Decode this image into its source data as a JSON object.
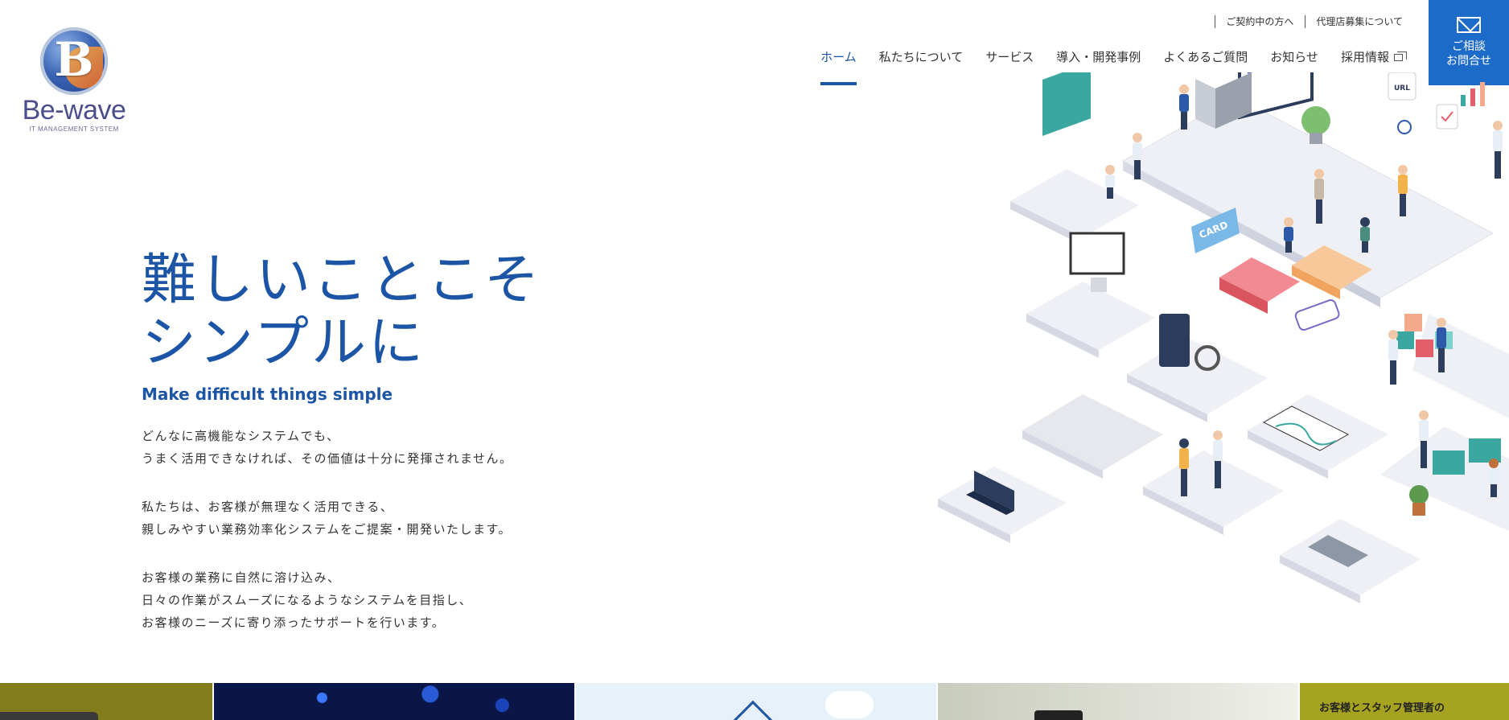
{
  "brand": {
    "logo_letter": "B",
    "name": "Be-wave",
    "tagline": "IT MANAGEMENT SYSTEM",
    "color_primary": "#1d55a6",
    "color_button": "#1d6bc8"
  },
  "subnav": [
    {
      "label": "ご契約中の方へ"
    },
    {
      "label": "代理店募集について"
    }
  ],
  "nav": [
    {
      "label": "ホーム",
      "active": true
    },
    {
      "label": "私たちについて"
    },
    {
      "label": "サービス"
    },
    {
      "label": "導入・開発事例"
    },
    {
      "label": "よくあるご質問"
    },
    {
      "label": "お知らせ"
    },
    {
      "label": "採用情報",
      "icon": "external-link-icon"
    }
  ],
  "contact": {
    "icon": "mail-icon",
    "line1": "ご相談",
    "line2": "お問合せ"
  },
  "hero": {
    "title_line1": "難しいことこそ",
    "title_line2": "シンプルに",
    "subtitle": "Make difficult things simple",
    "paragraphs": [
      [
        "どんなに高機能なシステムでも、",
        "うまく活用できなければ、その価値は十分に発揮されません。"
      ],
      [
        "私たちは、お客様が無理なく活用できる、",
        "親しみやすい業務効率化システムをご提案・開発いたします。"
      ],
      [
        "お客様の業務に自然に溶け込み、",
        "日々の作業がスムーズになるようなシステムを目指し、",
        "お客様のニーズに寄り添ったサポートを行います。"
      ]
    ]
  },
  "illustration": {
    "card_label": "CARD",
    "url_label": "URL"
  },
  "bottom_strip": {
    "banner_text": "お客様とスタッフ管理者の"
  }
}
